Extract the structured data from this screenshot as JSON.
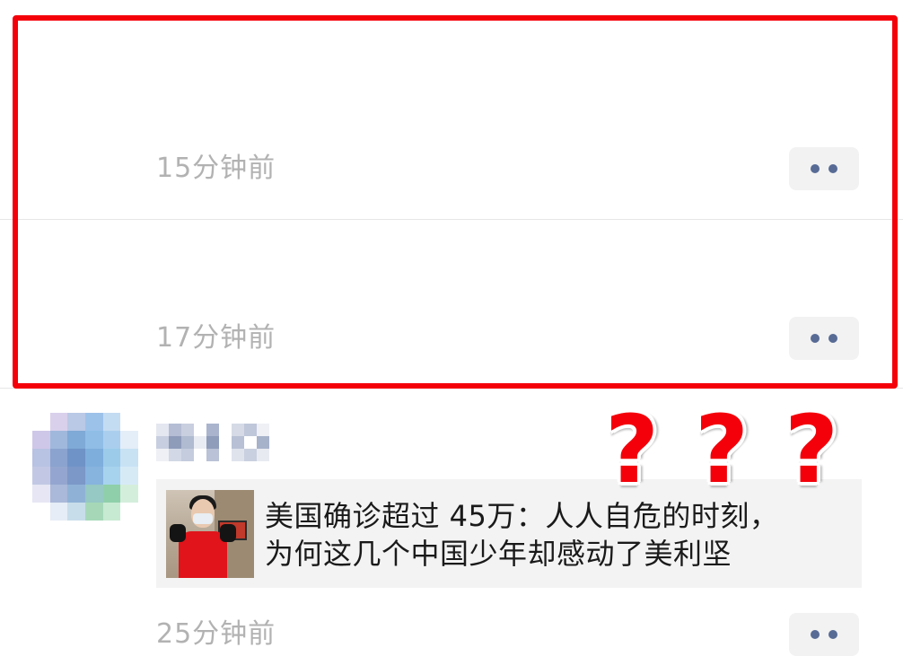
{
  "moments": [
    {
      "time": "15分钟前"
    },
    {
      "time": "17分钟前"
    },
    {
      "time": "25分钟前",
      "card": {
        "title_line1": "美国确诊超过 45万：人人自危的时刻，",
        "title_line2": "为何这几个中国少年却感动了美利坚"
      }
    }
  ],
  "annotations": {
    "question_marks": [
      "?",
      "?",
      "?"
    ],
    "highlight_color": "#f4000a"
  },
  "colors": {
    "link_blue": "#576b95",
    "timestamp_gray": "#b2b2b2",
    "card_bg": "#f3f3f3"
  }
}
